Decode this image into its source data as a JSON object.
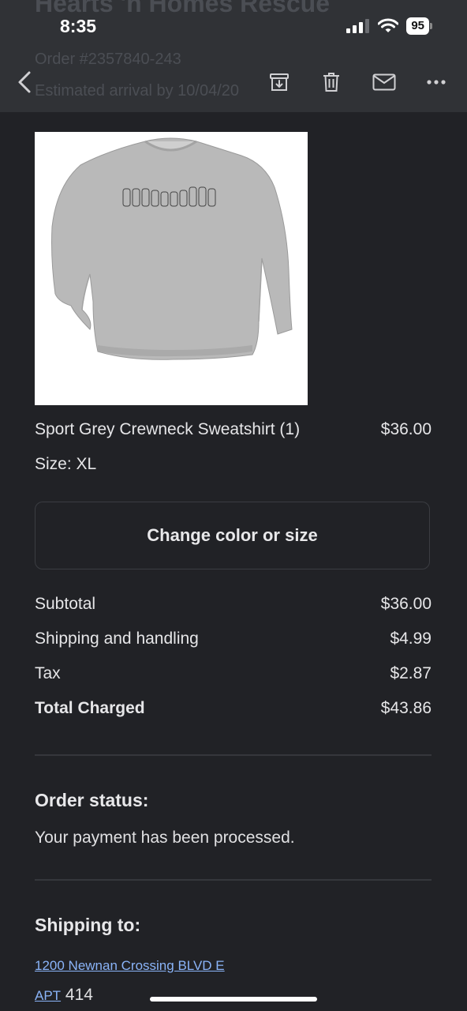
{
  "status_bar": {
    "time": "8:35",
    "battery": "95"
  },
  "header": {
    "ghost_title": "Hearts 'n Homes Rescue",
    "ghost_order": "Order #2357840-243",
    "ghost_estimate": "Estimated arrival by 10/04/20"
  },
  "product": {
    "name": "Sport Grey Crewneck Sweatshirt (1)",
    "price": "$36.00",
    "size": "Size: XL",
    "change_button": "Change color or size"
  },
  "summary": {
    "subtotal_label": "Subtotal",
    "subtotal_value": "$36.00",
    "shipping_label": "Shipping and handling",
    "shipping_value": "$4.99",
    "tax_label": "Tax",
    "tax_value": "$2.87",
    "total_label": "Total Charged",
    "total_value": "$43.86"
  },
  "order_status": {
    "heading": "Order status:",
    "text": "Your payment has been processed."
  },
  "shipping": {
    "heading": "Shipping to:",
    "address_line1": "1200 Newnan Crossing BLVD E",
    "apt_link": "APT",
    "apt_number": "414"
  },
  "colors": {
    "background": "#212226",
    "topbar": "#303236",
    "link": "#8ab4f8"
  }
}
